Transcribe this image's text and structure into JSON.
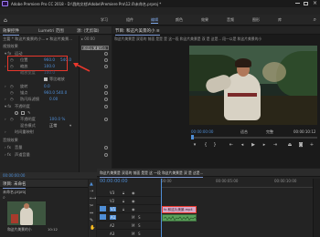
{
  "window": {
    "app_title": "Adobe Premiere Pro CC 2018 - D:\\我的文档\\Adobe\\Premiere Pro\\12.0\\未命名.prproj *",
    "menu": [
      "文件(F)",
      "编辑(E)",
      "剪辑(C)",
      "序列(S)",
      "标记(M)",
      "图形(G)",
      "窗口(W)",
      "帮助(H)"
    ],
    "workspaces": [
      "学习",
      "组件",
      "编辑",
      "颜色",
      "效果",
      "音频",
      "图形",
      "库"
    ],
    "active_workspace": "编辑"
  },
  "effect_controls": {
    "tabs": [
      "效果控件",
      "Lumetri 范围",
      "源: (无剪辑)"
    ],
    "clip_header": "主要 * 和这片美景的小... ▸ 和这片美景...",
    "section_video": "视频效果",
    "motion": "运动",
    "position_label": "位置",
    "position_x": "960.0",
    "position_y": "540.0",
    "scale_label": "缩放",
    "scale_value": "100.0",
    "scale_width_label": "缩放宽度",
    "scale_width_value": "100.0",
    "uniform_scale": "等比缩放",
    "rotation_label": "旋转",
    "rotation_value": "0.0",
    "anchor_label": "锚点",
    "anchor_value": "960.0   540.0",
    "antiflicker_label": "防闪烁滤镜",
    "antiflicker_value": "0.00",
    "opacity": "不透明度",
    "opacity_value": "100.0 %",
    "blend_label": "混合模式",
    "blend_value": "正常",
    "time_remap": "时间重映射",
    "section_audio": "音频效果",
    "volume": "音量",
    "channel_volume": "声道音量",
    "timecode": "00:00:00:00",
    "mini_clip": "和这片美景的小"
  },
  "program_monitor": {
    "title": "节目: 和这片美景的小 ≡",
    "subtitle": "和这片美景是 双语的 前面 是是 是 这一段 和这片美景是 双 是 这是... 段一以是 和这片美景的小",
    "timecode": "00:00:00:00",
    "fit": "适合",
    "quality": "完整",
    "duration": "00:00:10:12"
  },
  "project": {
    "title": "项目: 未命名",
    "name": "未命名.prproj",
    "clip_name": "和这片美景的小",
    "clip_duration": "10:12"
  },
  "timeline": {
    "title": "和这片美景是 双语的 前面 是是 这 一段 和这片美景是 双 是 这是...",
    "timecode": "00:00:00:00",
    "ruler_marks": [
      "00:00",
      "00:00:05:00",
      "00:00:10:00"
    ],
    "tracks": [
      "V3",
      "V2",
      "V1",
      "A1",
      "A2",
      "A3"
    ],
    "clip_label": "fx 和这片美景.mp4"
  },
  "colors": {
    "accent": "#4f8ed6",
    "highlight": "#e8372c",
    "clip_fx": "#d9a8c8",
    "audio_clip": "#5aa05a"
  }
}
